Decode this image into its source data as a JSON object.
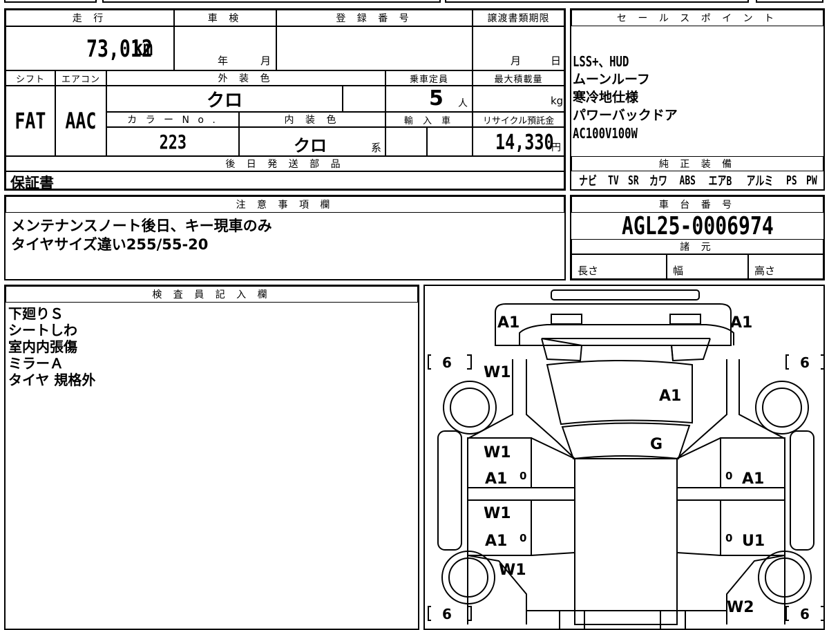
{
  "vehicle": {
    "mileage_label": "走 行",
    "mileage_value": "73,012",
    "mileage_unit": "km",
    "inspection_label": "車 検",
    "inspection_year": "年",
    "inspection_month": "月",
    "registration_label": "登 録 番 号",
    "transfer_label": "譲渡書類期限",
    "transfer_month": "月",
    "transfer_day": "日",
    "shift_label": "シフト",
    "shift_value": "FAT",
    "ac_label": "エアコン",
    "ac_value": "AAC",
    "exterior_color_label": "外 装 色",
    "exterior_color_value": "クロ",
    "capacity_label": "乗車定員",
    "capacity_value": "5",
    "capacity_unit": "人",
    "max_load_label": "最大積載量",
    "max_load_unit": "kg",
    "color_no_label": "カ ラ ー N o .",
    "color_no_value": "223",
    "interior_color_label": "内 装 色",
    "interior_color_value": "クロ",
    "interior_color_suffix": "系",
    "import_label": "輸 入 車",
    "recycle_label": "リサイクル預託金",
    "recycle_value": "14,330",
    "recycle_unit": "円",
    "later_parts_label": "後 日 発 送 部 品",
    "later_parts_value": "保証書"
  },
  "sales_points": {
    "label": "セ ー ル ス ポ イ ン ト",
    "lines": [
      "LSS+、HUD",
      "ムーンルーフ",
      "寒冷地仕様",
      "パワーバックドア",
      "AC100V100W"
    ]
  },
  "genuine_equipment": {
    "label": "純 正 装 備",
    "items": [
      "ナビ",
      "TV",
      "SR",
      "カワ",
      "ABS",
      "エアB",
      "アルミ",
      "PS",
      "PW"
    ]
  },
  "notes": {
    "label": "注 意 事 項 欄",
    "lines": [
      "メンテナンスノート後日、キー現車のみ",
      "タイヤサイズ違い255/55-20"
    ]
  },
  "chassis": {
    "label": "車 台 番 号",
    "value": "AGL25-0006974",
    "specs_label": "諸 元",
    "length_label": "長さ",
    "width_label": "幅",
    "height_label": "高さ"
  },
  "inspector": {
    "label": "検 査 員 記 入 欄",
    "lines": [
      "下廻りＳ",
      "シートしわ",
      "室内内張傷",
      "ミラーＡ",
      "タイヤ 規格外"
    ]
  },
  "diagram": {
    "marks": {
      "front_left_bumper": "A1",
      "front_right_bumper": "A1",
      "left_front_fender": "W1",
      "hood": "A1",
      "windshield": "G",
      "left_front_door_1": "W1",
      "left_front_door_2": "A1",
      "left_rear_door_1": "W1",
      "left_rear_door_2": "A1",
      "right_front_door": "A1",
      "right_rear_door": "U1",
      "left_rear_fender": "W1",
      "right_rear_fender": "W2"
    },
    "tire_tread_left_front": "6",
    "tire_tread_right_front": "6",
    "tire_tread_left_rear": "6",
    "tire_tread_right_rear": "6",
    "door_markers": [
      "0",
      "0",
      "0",
      "0"
    ]
  }
}
